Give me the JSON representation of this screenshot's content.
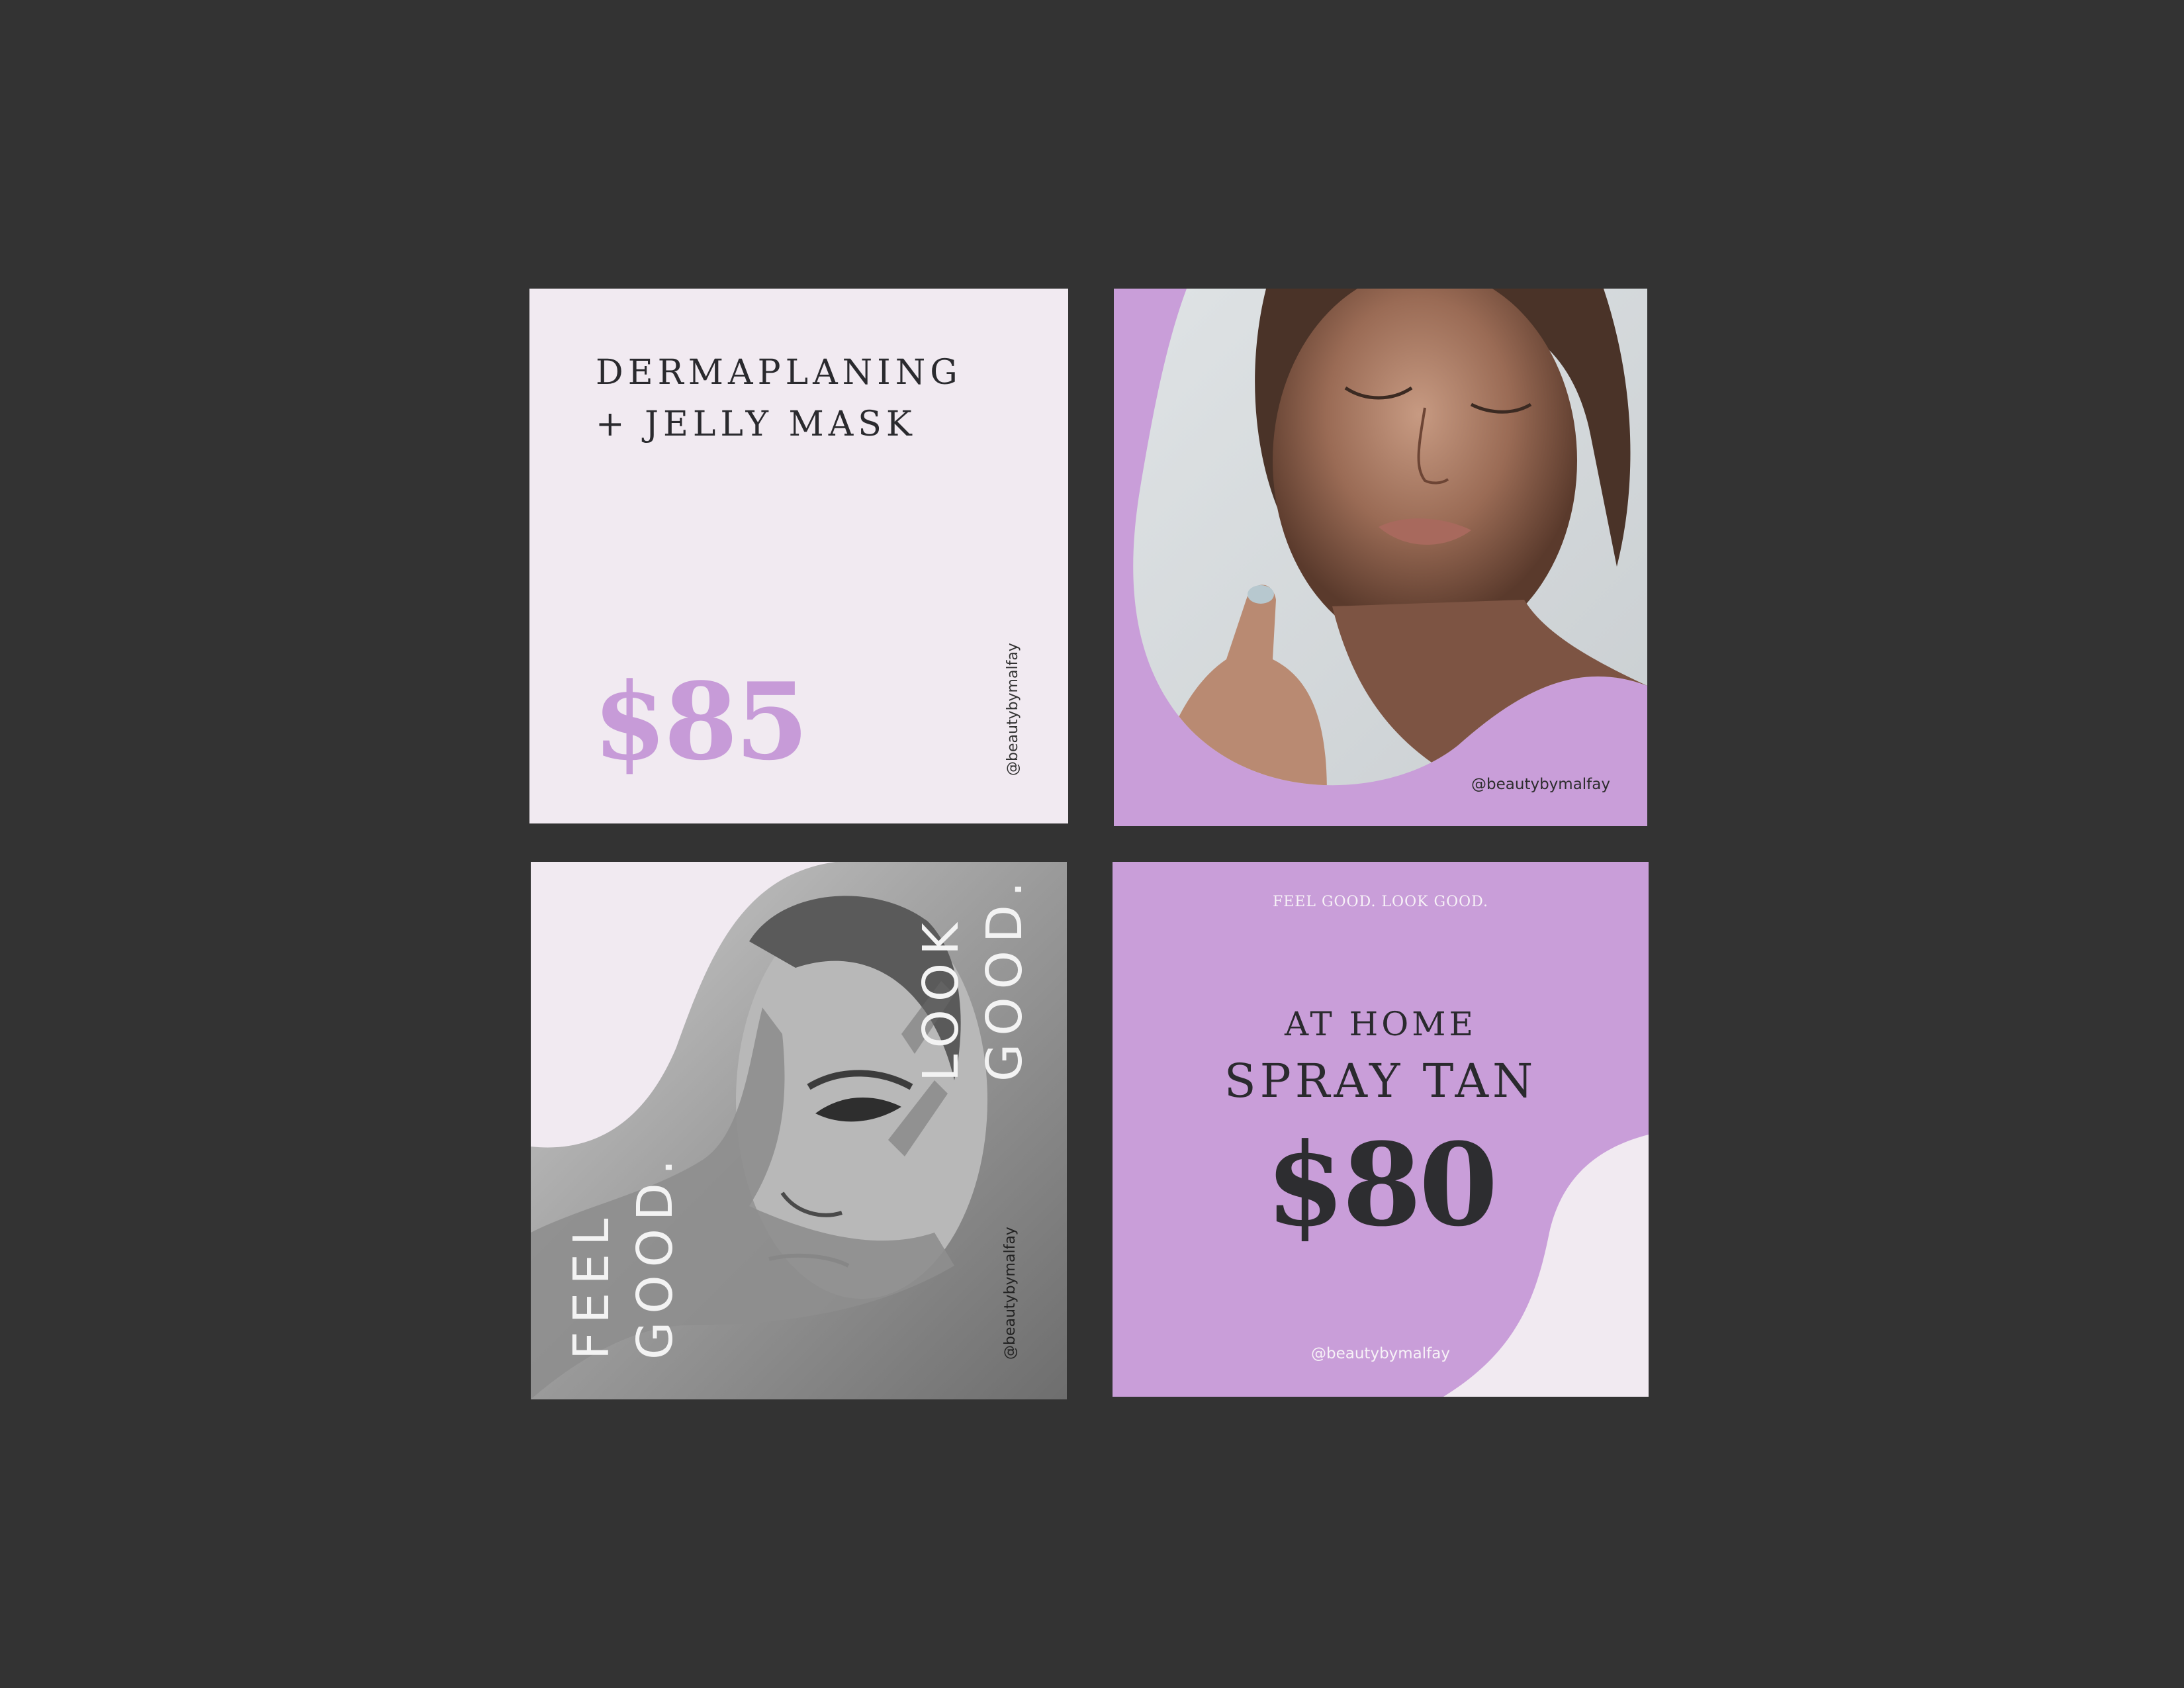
{
  "colors": {
    "background": "#333333",
    "lavender": "#c99ed9",
    "blush": "#f1eaf1",
    "charcoal": "#2a2a2e"
  },
  "cards": {
    "dermaplaning": {
      "title_line1": "DERMAPLANING",
      "title_line2": "+ JELLY MASK",
      "price": "$85",
      "handle": "@beautybymalfay"
    },
    "portrait": {
      "handle": "@beautybymalfay"
    },
    "feel_good": {
      "feel_line1": "FEEL",
      "feel_line2": "GOOD.",
      "look_line1": "LOOK",
      "look_line2": "GOOD.",
      "handle": "@beautybymalfay"
    },
    "spray_tan": {
      "tagline": "FEEL GOOD. LOOK GOOD.",
      "line1": "AT HOME",
      "line2": "SPRAY TAN",
      "price": "$80",
      "handle": "@beautybymalfay"
    }
  }
}
